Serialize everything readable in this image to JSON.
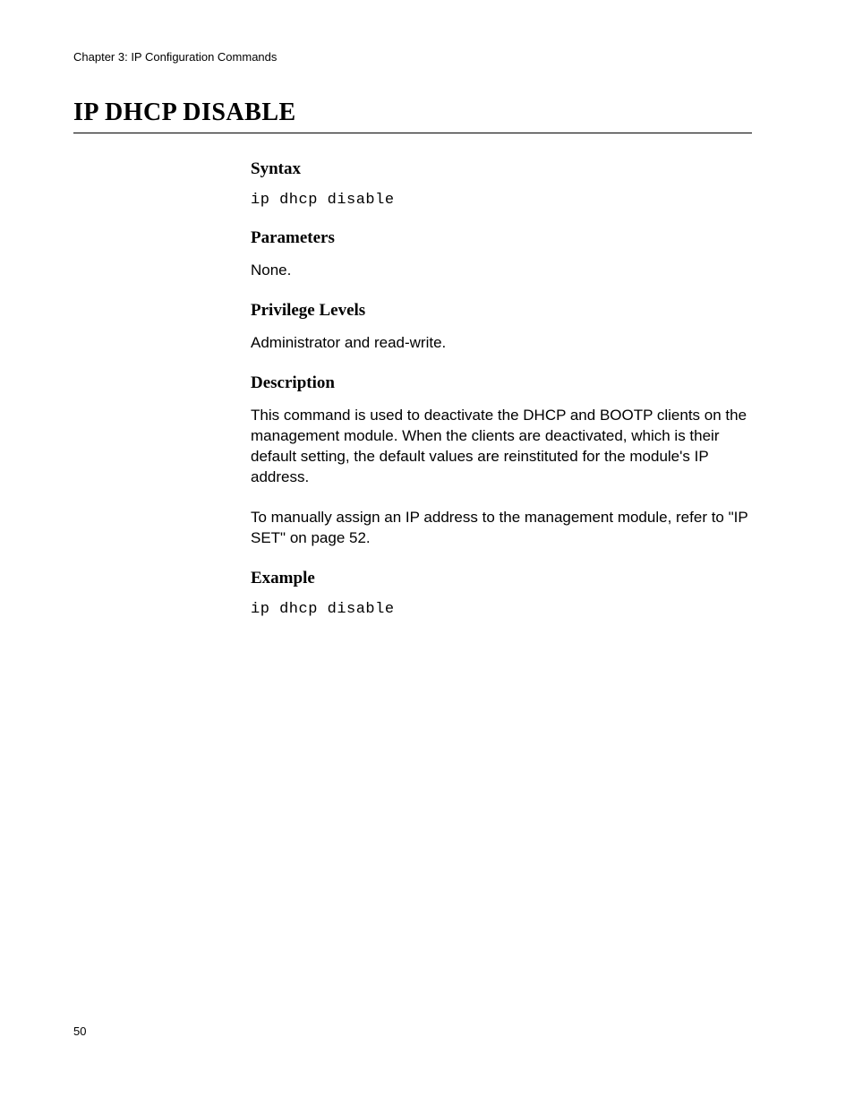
{
  "header": {
    "chapter": "Chapter 3: IP Configuration Commands"
  },
  "title": "IP DHCP DISABLE",
  "sections": {
    "syntax": {
      "heading": "Syntax",
      "code": "ip dhcp disable"
    },
    "parameters": {
      "heading": "Parameters",
      "text": "None."
    },
    "privilege": {
      "heading": "Privilege Levels",
      "text": "Administrator and read-write."
    },
    "description": {
      "heading": "Description",
      "para1": "This command is used to deactivate the DHCP and BOOTP clients on the management module. When the clients are deactivated, which is their default setting, the default values are reinstituted for the module's IP address.",
      "para2": "To manually assign an IP address to the management module, refer to \"IP SET\" on page 52."
    },
    "example": {
      "heading": "Example",
      "code": "ip dhcp disable"
    }
  },
  "footer": {
    "page_number": "50"
  }
}
